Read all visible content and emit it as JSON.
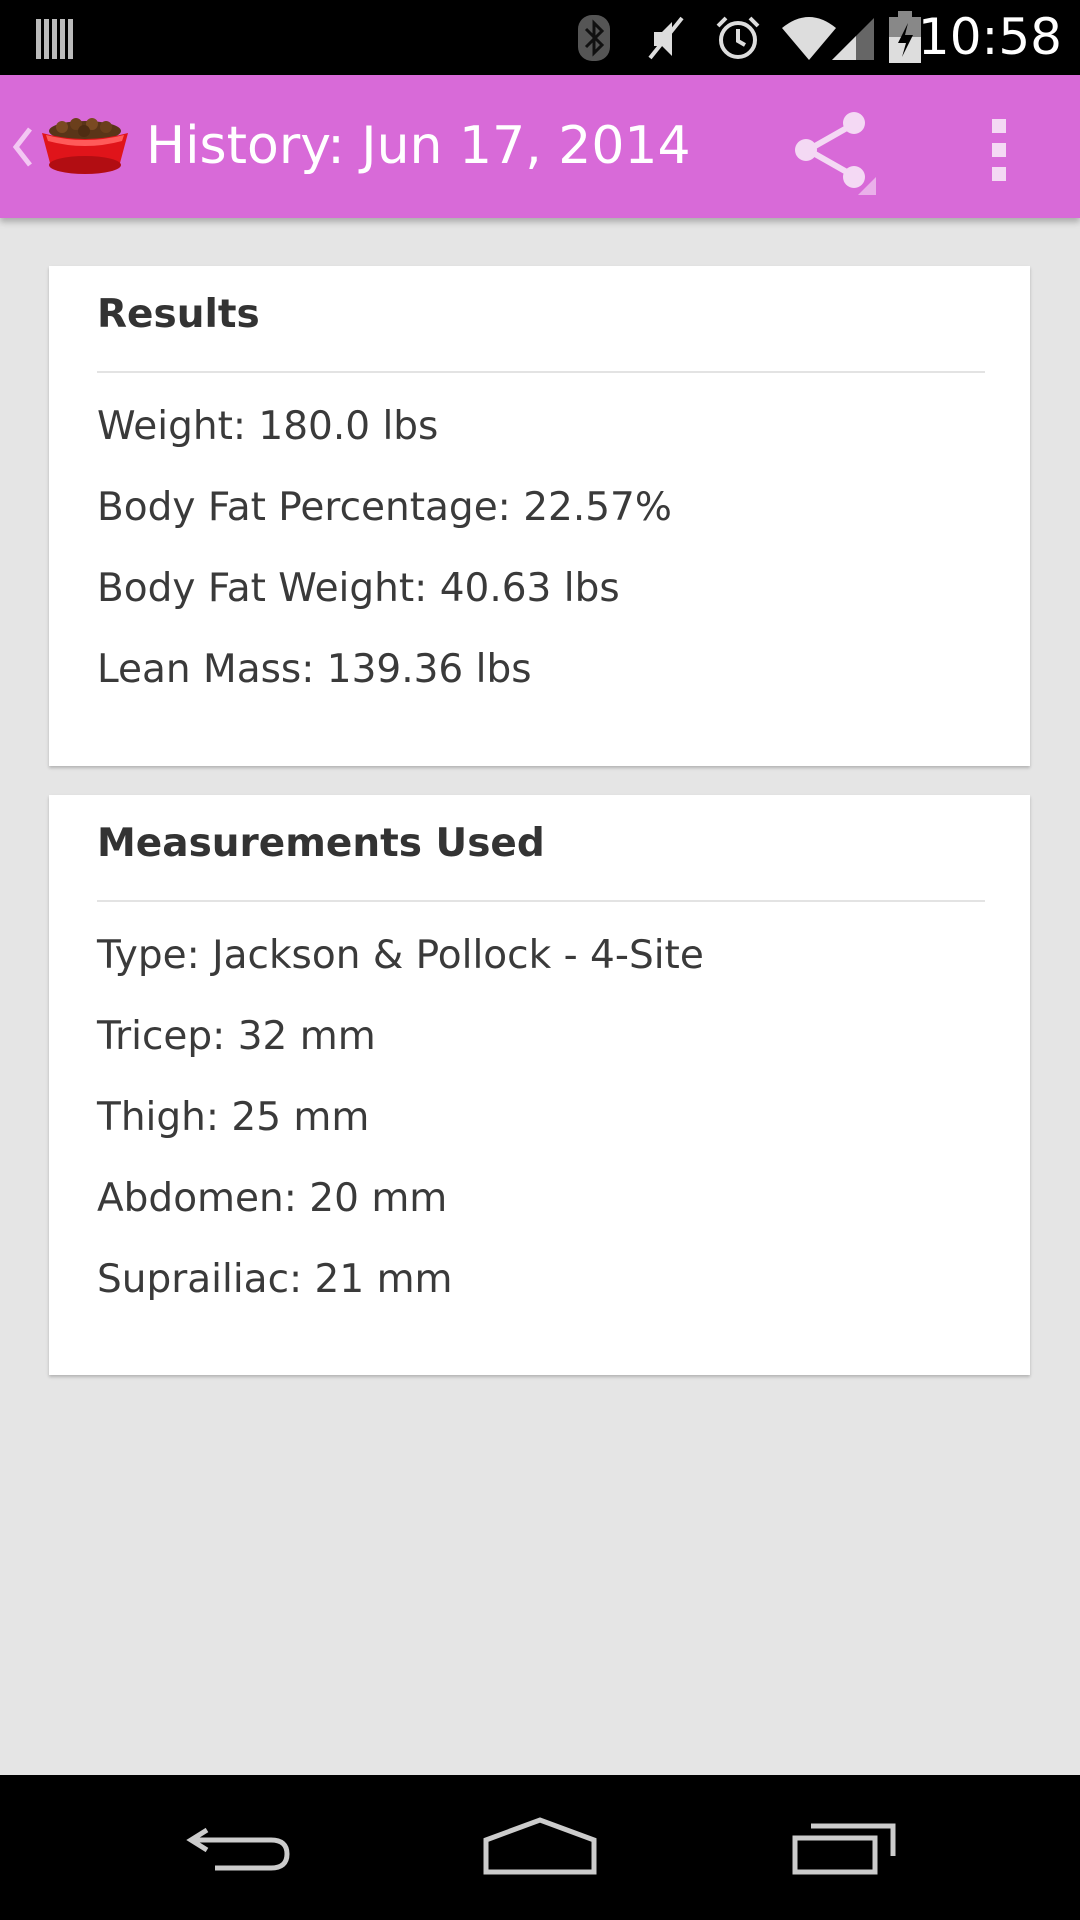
{
  "status_bar": {
    "time": "10:58",
    "icons": [
      "notification-bars-icon",
      "bluetooth-icon",
      "muted-icon",
      "alarm-icon",
      "wifi-icon",
      "signal-icon",
      "battery-charging-icon"
    ]
  },
  "action_bar": {
    "title": "History: Jun 17, 2014",
    "background": "#d86ad8",
    "icons": [
      "back-caret-icon",
      "dog-bowl-icon",
      "share-icon",
      "overflow-menu-icon"
    ]
  },
  "results": {
    "title": "Results",
    "rows": [
      "Weight: 180.0 lbs",
      "Body Fat Percentage: 22.57%",
      "Body Fat Weight: 40.63 lbs",
      "Lean Mass: 139.36 lbs"
    ]
  },
  "measurements": {
    "title": "Measurements Used",
    "rows": [
      "Type: Jackson & Pollock - 4-Site",
      "Tricep: 32 mm",
      "Thigh: 25 mm",
      "Abdomen: 20 mm",
      "Suprailiac: 21 mm"
    ]
  },
  "nav_bar": {
    "icons": [
      "back-icon",
      "home-icon",
      "recent-apps-icon"
    ]
  }
}
